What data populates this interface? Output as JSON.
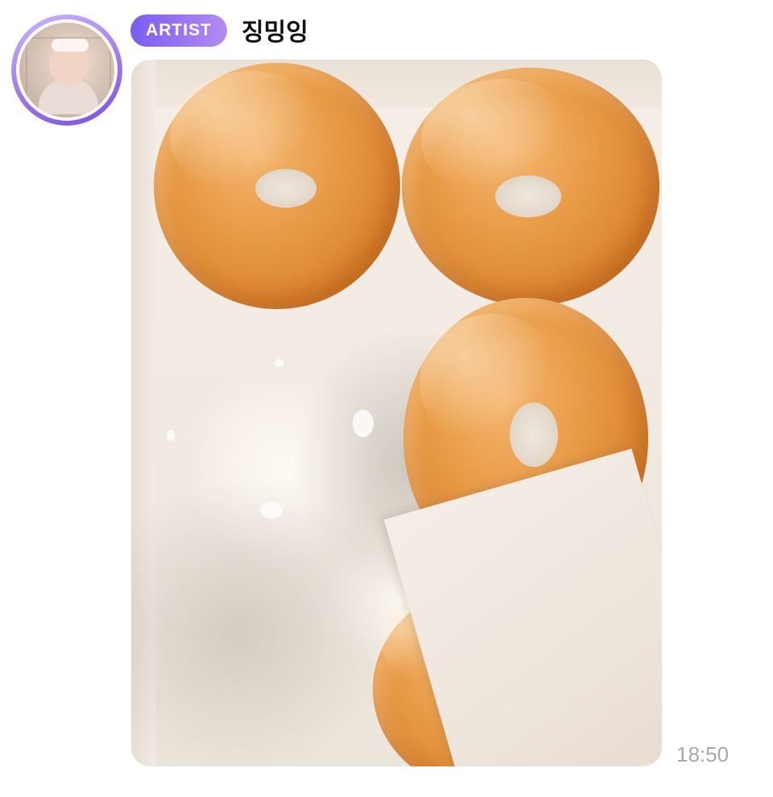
{
  "message": {
    "badge_label": "ARTIST",
    "sender_name": "징밍잉",
    "timestamp": "18:50",
    "avatar": "baby-photo-avatar",
    "attachment": "donut-box-photo"
  },
  "colors": {
    "badge_gradient_start": "#7b5cf2",
    "badge_gradient_end": "#b38bf0",
    "avatar_ring": "#a67cf0",
    "timestamp": "#a8a8ad"
  }
}
